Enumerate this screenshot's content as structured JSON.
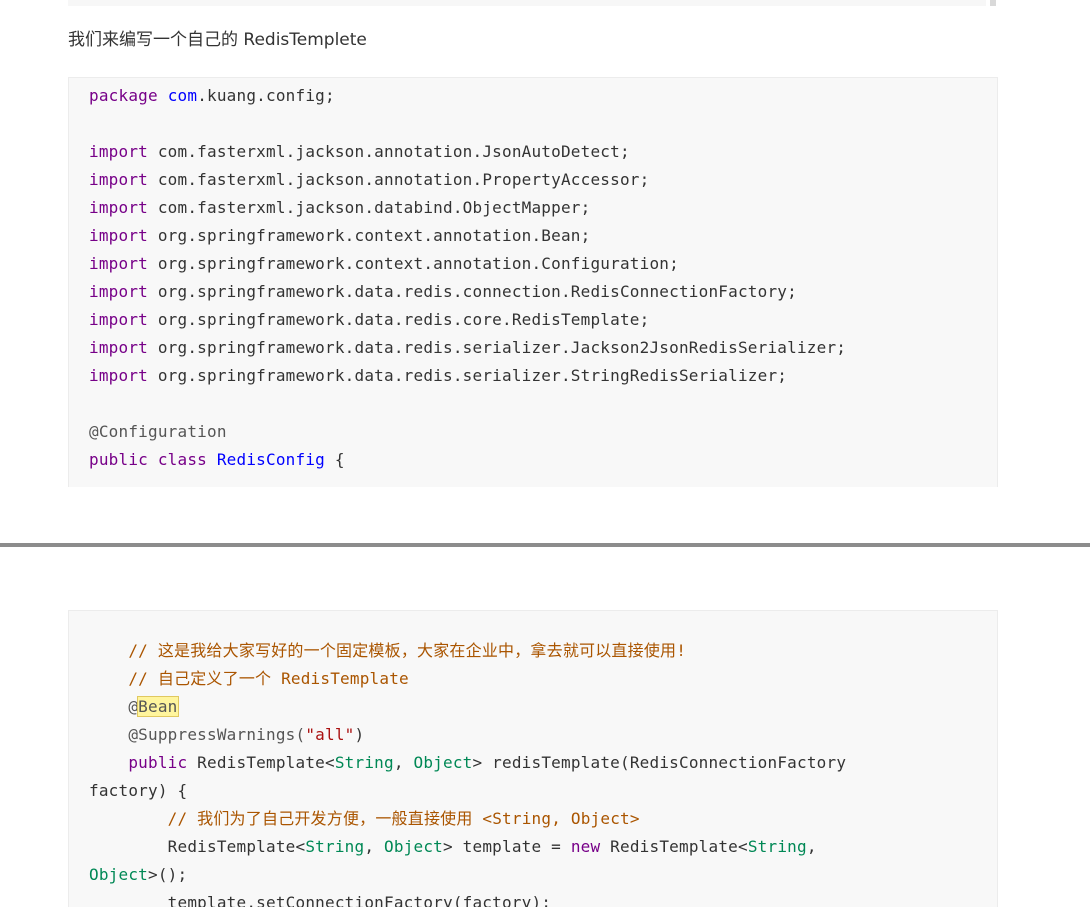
{
  "intro_text": "我们来编写一个自己的 RedisTemplete",
  "code1": {
    "package_kw": "package",
    "package_com": "com",
    "package_rest": ".kuang.config;",
    "import_kw": "import",
    "imports": [
      " com.fasterxml.jackson.annotation.JsonAutoDetect;",
      " com.fasterxml.jackson.annotation.PropertyAccessor;",
      " com.fasterxml.jackson.databind.ObjectMapper;",
      " org.springframework.context.annotation.Bean;",
      " org.springframework.context.annotation.Configuration;",
      " org.springframework.data.redis.connection.RedisConnectionFactory;",
      " org.springframework.data.redis.core.RedisTemplate;",
      " org.springframework.data.redis.serializer.Jackson2JsonRedisSerializer;",
      " org.springframework.data.redis.serializer.StringRedisSerializer;"
    ],
    "annotation": "@Configuration",
    "class_kw": "public class ",
    "class_name": "RedisConfig",
    "class_brace": " {"
  },
  "code2": {
    "comment1": "    // 这是我给大家写好的一个固定模板，大家在企业中，拿去就可以直接使用!",
    "comment2": "    // 自己定义了一个 RedisTemplate",
    "at_sign": "    @",
    "bean": "Bean",
    "suppress_pre": "    @SuppressWarnings(",
    "suppress_str": "\"all\"",
    "suppress_post": ")",
    "method_public": "    public",
    "method_rt": " RedisTemplate<",
    "type_string": "String",
    "comma": ", ",
    "type_object": "Object",
    "method_rest": "> redisTemplate(RedisConnectionFactory",
    "factory_line": "factory) {",
    "comment3": "        // 我们为了自己开发方便，一般直接使用 <String, Object>",
    "tmpl_pre": "        RedisTemplate<",
    "tmpl_mid": "> template = ",
    "kw_new": "new",
    "tmpl_rt2": " RedisTemplate<",
    "tmpl_comma_end": ",",
    "obj_line_end": ">();",
    "set_factory": "        template.setConnectionFactory(factory);"
  }
}
